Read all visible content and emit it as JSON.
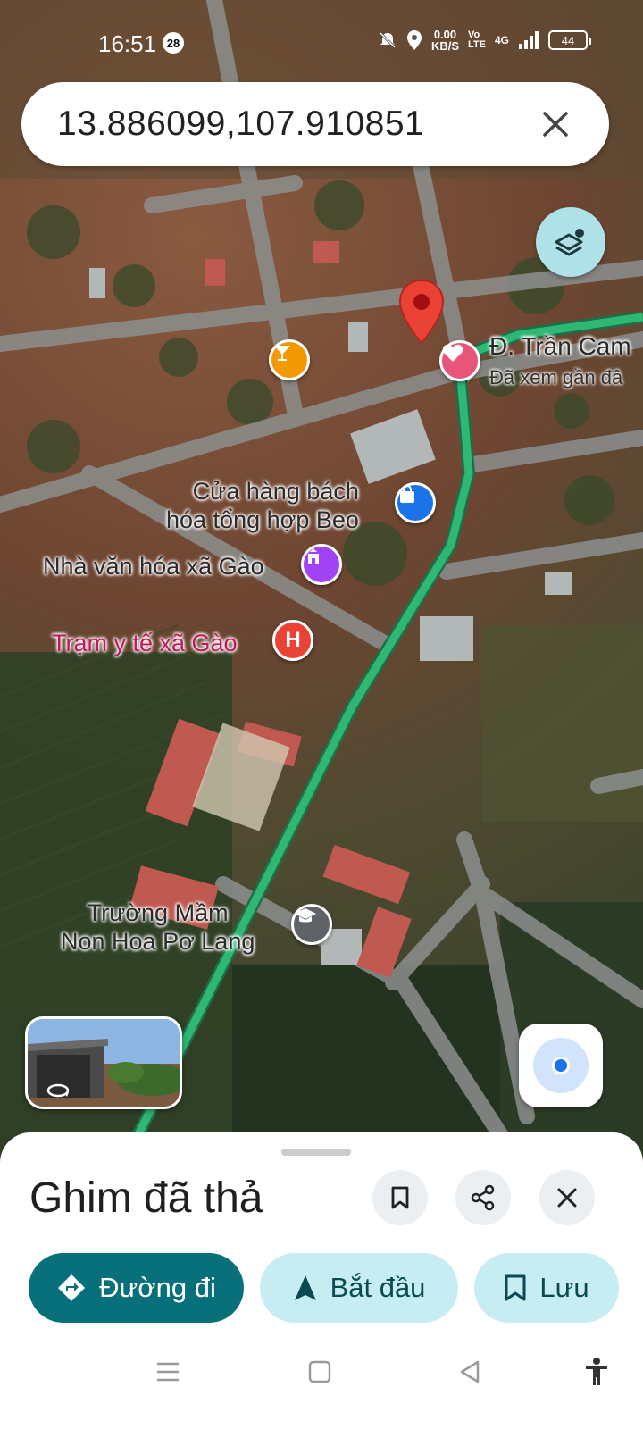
{
  "status_bar": {
    "time": "16:51",
    "notification_count": "28",
    "speed_value": "0.00",
    "speed_unit": "KB/S",
    "network": "4G",
    "battery": "44"
  },
  "search": {
    "query": "13.886099,107.910851"
  },
  "map": {
    "road_label": "Đ. Trần Cam",
    "road_sub": "Đã xem gần đâ",
    "pois": {
      "store": "Cửa hàng bách\nhóa tổng hợp Beo",
      "culture_house": "Nhà văn hóa xã Gào",
      "health_station": "Trạm y tế xã Gào",
      "kindergarten": "Trường Mầm\nNon Hoa Pơ Lang"
    },
    "colors": {
      "route": "#2fb774",
      "pin": "#ea4335",
      "bar_pin": "#f29900",
      "store_pin": "#1a73e8",
      "culture_pin": "#a142f4",
      "hospital_pin": "#ea4335",
      "school_pin": "#5f6368",
      "saved_pin": "#e8547a"
    }
  },
  "sheet": {
    "title": "Ghim đã thả",
    "directions_label": "Đường đi",
    "start_label": "Bắt đầu",
    "save_label": "Lưu"
  }
}
